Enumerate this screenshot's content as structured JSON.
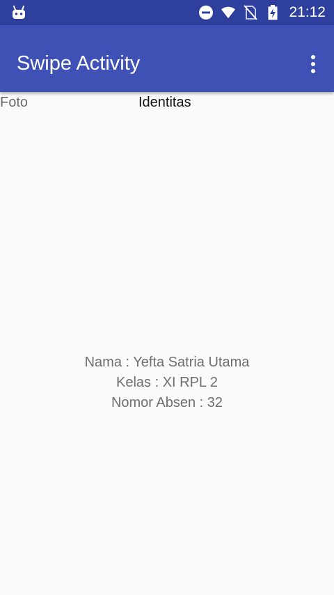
{
  "status_bar": {
    "time": "21:12",
    "icons": [
      "android-icon",
      "do-not-disturb-icon",
      "wifi-icon",
      "no-sim-icon",
      "battery-charging-icon"
    ]
  },
  "app_bar": {
    "title": "Swipe Activity",
    "menu_icon": "more-vert-icon"
  },
  "tabs": [
    {
      "label": "Foto"
    },
    {
      "label": "Identitas"
    }
  ],
  "identity": {
    "name_line": "Nama : Yefta Satria Utama",
    "class_line": "Kelas : XI RPL 2",
    "number_line": "Nomor Absen : 32"
  },
  "colors": {
    "status_bar": "#2f3f9e",
    "app_bar": "#3f51b5",
    "background": "#fafafa"
  }
}
